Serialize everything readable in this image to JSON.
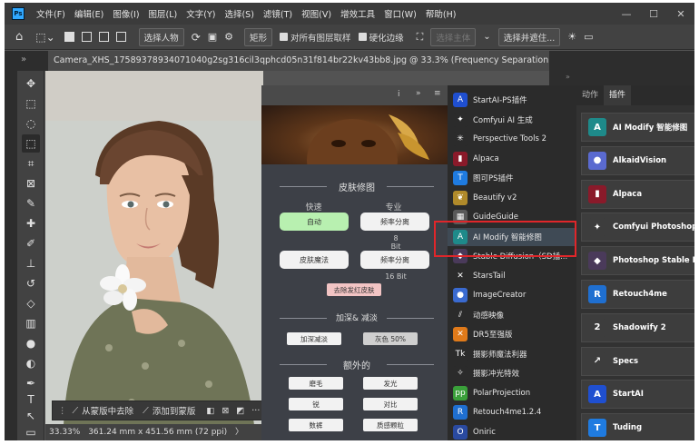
{
  "app": {
    "logo": "Ps"
  },
  "menu": [
    "文件(F)",
    "编辑(E)",
    "图像(I)",
    "图层(L)",
    "文字(Y)",
    "选择(S)",
    "滤镜(T)",
    "视图(V)",
    "增效工具",
    "窗口(W)",
    "帮助(H)"
  ],
  "window_controls": {
    "min": "—",
    "max": "☐",
    "close": "✕"
  },
  "options": {
    "select_subject": "选择人物",
    "mode": "矩形",
    "sample_all_layers": "对所有图层取样",
    "hard_edge": "硬化边缘",
    "select_subject_btn": "选择主体",
    "select_and_mask": "选择并遮住..."
  },
  "tabs": {
    "left_collapse": "»",
    "doc": "Camera_XHS_17589378934071040g2sg316cil3qphcd05n31f814br22kv43bb8.jpg @ 33.3% (Frequency Separation, 图层蒙版/8) *",
    "close": "×"
  },
  "status": {
    "zoom": "33.33%",
    "size": "361.24 mm x 451.56 mm (72 ppi)",
    "arrow": "〉"
  },
  "context_bar": {
    "subtract": "从蒙版中去除",
    "add": "添加到蒙版",
    "more": "···"
  },
  "plugin": {
    "header_collapse": "»",
    "skin_title": "皮肤修图",
    "fast": "快速",
    "pro": "专业",
    "auto": "自动",
    "freq_sep": "频率分离",
    "bit8": "8 Bit",
    "skin_magic": "皮肤魔法",
    "freq_sep2": "频率分离",
    "bit16": "16 Bit",
    "remove_red": "去除发红皮肤",
    "dodge_title": "加深& 减淡",
    "dodge_add": "加深减淡",
    "gray50": "灰色 50%",
    "extra_title": "额外的",
    "btn_a": "磨毛",
    "btn_b": "发光",
    "btn_c": "锐",
    "btn_d": "对比",
    "btn_e": "数裤",
    "btn_f": "质感颗粒"
  },
  "plugin_list": [
    {
      "name": "StartAI-PS插件",
      "icon": "startai-icon",
      "color": "#1f4fd0"
    },
    {
      "name": "Comfyui AI 生成",
      "icon": "sparkle-icon",
      "color": "#2b2b2b"
    },
    {
      "name": "Perspective Tools 2",
      "icon": "burst-icon",
      "color": "#2b2b2b"
    },
    {
      "name": "Alpaca",
      "icon": "alpaca-icon",
      "color": "#8a1a2a"
    },
    {
      "name": "图可PS插件",
      "icon": "tuke-icon",
      "color": "#1f7be0"
    },
    {
      "name": "Beautify v2",
      "icon": "leaf-icon",
      "color": "#b08a2a"
    },
    {
      "name": "GuideGuide",
      "icon": "grid-icon",
      "color": "#5a5a5a"
    },
    {
      "name": "AI Modify 智能修图",
      "icon": "aimodify-icon",
      "color": "#1e8a8a"
    },
    {
      "name": "Stable Diffusion（SD插...",
      "icon": "sd-icon",
      "color": "#4a3a5a"
    },
    {
      "name": "StarsTail",
      "icon": "x-icon",
      "color": "#2b2b2b"
    },
    {
      "name": "ImageCreator",
      "icon": "orb-icon",
      "color": "#3a6ad0"
    },
    {
      "name": "动感映像",
      "icon": "stripes-icon",
      "color": "#2b2b2b"
    },
    {
      "name": "DR5至强版",
      "icon": "cross-icon",
      "color": "#e07a1a"
    },
    {
      "name": "摄影师魔法利器",
      "icon": "tk-icon",
      "color": "#2b2b2b"
    },
    {
      "name": "摄影冲光特效",
      "icon": "flash-icon",
      "color": "#2b2b2b"
    },
    {
      "name": "PolarProjection",
      "icon": "pp-icon",
      "color": "#3aa03a"
    },
    {
      "name": "Retouch4me1.2.4",
      "icon": "r4m-icon",
      "color": "#1f6fd0"
    },
    {
      "name": "Oniric",
      "icon": "o-icon",
      "color": "#2a4aa0"
    }
  ],
  "right_panel": {
    "tab_actions": "动作",
    "tab_plugins": "插件",
    "items": [
      {
        "name": "AI Modify 智能修图",
        "icon": "aimodify-icon",
        "color": "#1e8a8a"
      },
      {
        "name": "AlkaidVision",
        "icon": "orb-icon",
        "color": "#5a6ad0"
      },
      {
        "name": "Alpaca",
        "icon": "alpaca-icon",
        "color": "#8a1a2a"
      },
      {
        "name": "Comfyui Photoshop",
        "icon": "sparkle-icon",
        "color": "#3d3d3d"
      },
      {
        "name": "Photoshop Stable Diffusion",
        "icon": "sd-icon",
        "color": "#4a3a5a"
      },
      {
        "name": "Retouch4me",
        "icon": "r4m-icon",
        "color": "#1f6fd0"
      },
      {
        "name": "Shadowify 2",
        "icon": "shadowify-icon",
        "color": "#3d3d3d"
      },
      {
        "name": "Specs",
        "icon": "arrow-icon",
        "color": "#3d3d3d"
      },
      {
        "name": "StartAI",
        "icon": "startai-icon",
        "color": "#1f4fd0"
      },
      {
        "name": "Tuding",
        "icon": "tuding-icon",
        "color": "#1f7be0"
      }
    ]
  }
}
